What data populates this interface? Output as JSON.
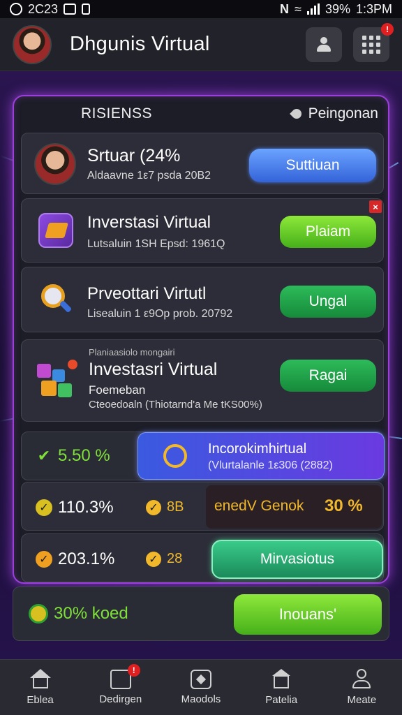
{
  "status_bar": {
    "time_left": "2C23",
    "battery": "39%",
    "clock": "1:3PM"
  },
  "header": {
    "title": "Dhgunis Virtual",
    "grid_badge": "!"
  },
  "panel": {
    "title": "RISIENSS",
    "right_label": "Peingonan"
  },
  "cards": [
    {
      "title": "Srtuar (24%",
      "subtitle": "Aldaavne 1ε7 psda 20B2",
      "button": "Suttiuan"
    },
    {
      "title": "Inverstasi Virtual",
      "subtitle": "Lutsaluin 1SH Epsd: 1961Q",
      "button": "Plaiam",
      "close": "×"
    },
    {
      "title": "Prveottari Virtutl",
      "subtitle": "Lisealuin 1 ε9Op prob. 20792",
      "button": "Ungal"
    },
    {
      "small_header": "Planiaasiolo mongairi",
      "title": "Investasri Virtual",
      "line1": "Foemeban",
      "line2": "Cteoedoaln (Thiotarnd'a Me tKS00%)",
      "button": "Ragai"
    }
  ],
  "stats": {
    "row1_left": "5.50 %",
    "row1_banner_title": "Incorokimhirtual",
    "row1_banner_sub": "(Vlurtalanle 1ε306 (2882)",
    "row2_left": "110.3%",
    "row2_mid": "8B",
    "row2_label": "enedV Genok",
    "row2_value": "30 %",
    "row3_left": "203.1%",
    "row3_mid": "28",
    "row3_button": "Mirvasiotus",
    "row4_left": "30% koed",
    "row4_button": "Inouans'"
  },
  "bottom_nav": [
    {
      "label": "Eblea",
      "icon": "home-icon"
    },
    {
      "label": "Dedirgen",
      "icon": "calendar-icon",
      "badge": "!"
    },
    {
      "label": "Maodols",
      "icon": "modules-icon"
    },
    {
      "label": "Patelia",
      "icon": "store-icon"
    },
    {
      "label": "Meate",
      "icon": "profile-icon"
    }
  ],
  "colors": {
    "accent_purple": "#9a3fd9",
    "blue": "#3463d9",
    "lime": "#46b01a",
    "green": "#168a3a",
    "gold": "#f0b82a"
  }
}
